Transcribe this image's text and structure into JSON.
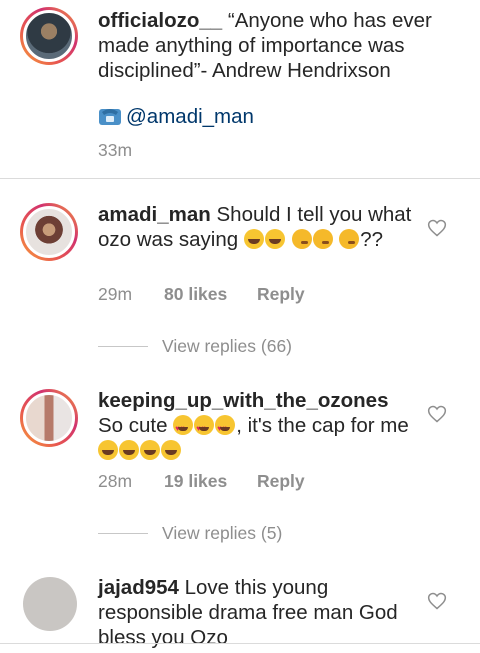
{
  "comments": [
    {
      "username": "officialozo__",
      "text": " “Anyone who has ever made anything of importance was disciplined”- Andrew Hendrixson",
      "mention": "@amadi_man",
      "time": "33m"
    },
    {
      "username": "amadi_man",
      "text": " Should I tell you what ozo was saying ",
      "text_after": "??",
      "time": "29m",
      "likes": "80 likes",
      "reply": "Reply",
      "view_replies": "View replies (66)"
    },
    {
      "username": "keeping_up_with_the_ozones",
      "text": " So cute ",
      "text_mid": ", it's the cap for me",
      "time": "28m",
      "likes": "19 likes",
      "reply": "Reply",
      "view_replies": "View replies (5)"
    },
    {
      "username": "jajad954",
      "text": " Love this young responsible drama free man God bless you Ozo"
    }
  ],
  "icons": {
    "like": "heart-outline-icon",
    "phone": "telephone-icon"
  },
  "colors": {
    "story_ring": "#e8584f",
    "muted": "#8e8e8e",
    "mention": "#00376b"
  }
}
